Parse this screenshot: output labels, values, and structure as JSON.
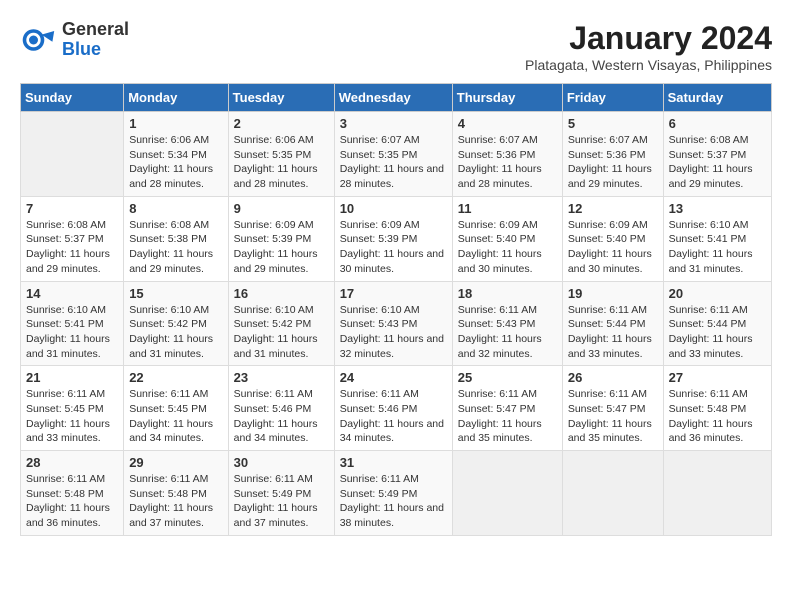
{
  "header": {
    "logo": {
      "general": "General",
      "blue": "Blue"
    },
    "title": "January 2024",
    "subtitle": "Platagata, Western Visayas, Philippines"
  },
  "days_of_week": [
    "Sunday",
    "Monday",
    "Tuesday",
    "Wednesday",
    "Thursday",
    "Friday",
    "Saturday"
  ],
  "weeks": [
    [
      {
        "day": "",
        "info": ""
      },
      {
        "day": "1",
        "info": "Sunrise: 6:06 AM\nSunset: 5:34 PM\nDaylight: 11 hours and 28 minutes."
      },
      {
        "day": "2",
        "info": "Sunrise: 6:06 AM\nSunset: 5:35 PM\nDaylight: 11 hours and 28 minutes."
      },
      {
        "day": "3",
        "info": "Sunrise: 6:07 AM\nSunset: 5:35 PM\nDaylight: 11 hours and 28 minutes."
      },
      {
        "day": "4",
        "info": "Sunrise: 6:07 AM\nSunset: 5:36 PM\nDaylight: 11 hours and 28 minutes."
      },
      {
        "day": "5",
        "info": "Sunrise: 6:07 AM\nSunset: 5:36 PM\nDaylight: 11 hours and 29 minutes."
      },
      {
        "day": "6",
        "info": "Sunrise: 6:08 AM\nSunset: 5:37 PM\nDaylight: 11 hours and 29 minutes."
      }
    ],
    [
      {
        "day": "7",
        "info": "Sunrise: 6:08 AM\nSunset: 5:37 PM\nDaylight: 11 hours and 29 minutes."
      },
      {
        "day": "8",
        "info": "Sunrise: 6:08 AM\nSunset: 5:38 PM\nDaylight: 11 hours and 29 minutes."
      },
      {
        "day": "9",
        "info": "Sunrise: 6:09 AM\nSunset: 5:39 PM\nDaylight: 11 hours and 29 minutes."
      },
      {
        "day": "10",
        "info": "Sunrise: 6:09 AM\nSunset: 5:39 PM\nDaylight: 11 hours and 30 minutes."
      },
      {
        "day": "11",
        "info": "Sunrise: 6:09 AM\nSunset: 5:40 PM\nDaylight: 11 hours and 30 minutes."
      },
      {
        "day": "12",
        "info": "Sunrise: 6:09 AM\nSunset: 5:40 PM\nDaylight: 11 hours and 30 minutes."
      },
      {
        "day": "13",
        "info": "Sunrise: 6:10 AM\nSunset: 5:41 PM\nDaylight: 11 hours and 31 minutes."
      }
    ],
    [
      {
        "day": "14",
        "info": "Sunrise: 6:10 AM\nSunset: 5:41 PM\nDaylight: 11 hours and 31 minutes."
      },
      {
        "day": "15",
        "info": "Sunrise: 6:10 AM\nSunset: 5:42 PM\nDaylight: 11 hours and 31 minutes."
      },
      {
        "day": "16",
        "info": "Sunrise: 6:10 AM\nSunset: 5:42 PM\nDaylight: 11 hours and 31 minutes."
      },
      {
        "day": "17",
        "info": "Sunrise: 6:10 AM\nSunset: 5:43 PM\nDaylight: 11 hours and 32 minutes."
      },
      {
        "day": "18",
        "info": "Sunrise: 6:11 AM\nSunset: 5:43 PM\nDaylight: 11 hours and 32 minutes."
      },
      {
        "day": "19",
        "info": "Sunrise: 6:11 AM\nSunset: 5:44 PM\nDaylight: 11 hours and 33 minutes."
      },
      {
        "day": "20",
        "info": "Sunrise: 6:11 AM\nSunset: 5:44 PM\nDaylight: 11 hours and 33 minutes."
      }
    ],
    [
      {
        "day": "21",
        "info": "Sunrise: 6:11 AM\nSunset: 5:45 PM\nDaylight: 11 hours and 33 minutes."
      },
      {
        "day": "22",
        "info": "Sunrise: 6:11 AM\nSunset: 5:45 PM\nDaylight: 11 hours and 34 minutes."
      },
      {
        "day": "23",
        "info": "Sunrise: 6:11 AM\nSunset: 5:46 PM\nDaylight: 11 hours and 34 minutes."
      },
      {
        "day": "24",
        "info": "Sunrise: 6:11 AM\nSunset: 5:46 PM\nDaylight: 11 hours and 34 minutes."
      },
      {
        "day": "25",
        "info": "Sunrise: 6:11 AM\nSunset: 5:47 PM\nDaylight: 11 hours and 35 minutes."
      },
      {
        "day": "26",
        "info": "Sunrise: 6:11 AM\nSunset: 5:47 PM\nDaylight: 11 hours and 35 minutes."
      },
      {
        "day": "27",
        "info": "Sunrise: 6:11 AM\nSunset: 5:48 PM\nDaylight: 11 hours and 36 minutes."
      }
    ],
    [
      {
        "day": "28",
        "info": "Sunrise: 6:11 AM\nSunset: 5:48 PM\nDaylight: 11 hours and 36 minutes."
      },
      {
        "day": "29",
        "info": "Sunrise: 6:11 AM\nSunset: 5:48 PM\nDaylight: 11 hours and 37 minutes."
      },
      {
        "day": "30",
        "info": "Sunrise: 6:11 AM\nSunset: 5:49 PM\nDaylight: 11 hours and 37 minutes."
      },
      {
        "day": "31",
        "info": "Sunrise: 6:11 AM\nSunset: 5:49 PM\nDaylight: 11 hours and 38 minutes."
      },
      {
        "day": "",
        "info": ""
      },
      {
        "day": "",
        "info": ""
      },
      {
        "day": "",
        "info": ""
      }
    ]
  ]
}
